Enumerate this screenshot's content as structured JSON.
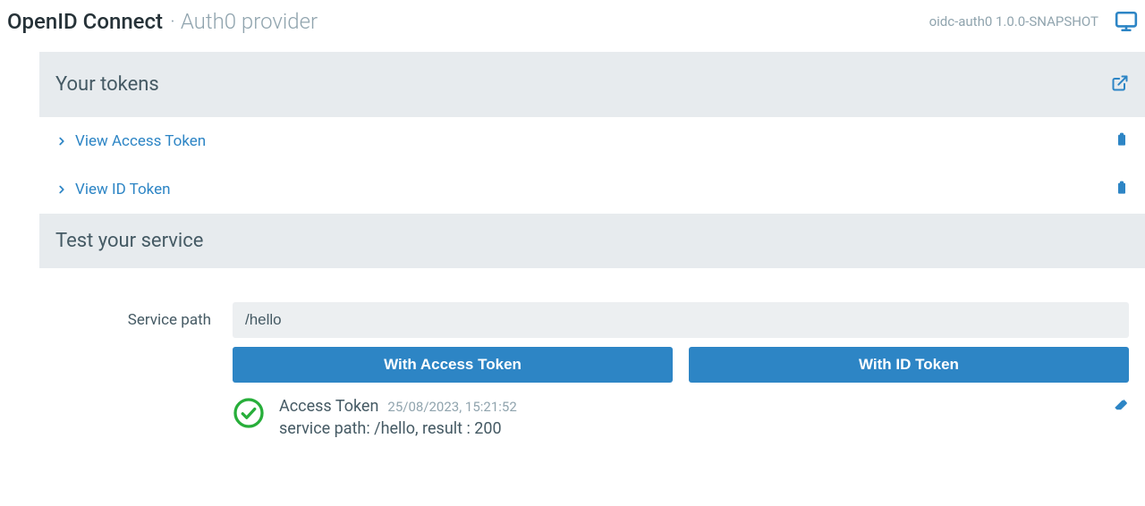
{
  "header": {
    "title": "OpenID Connect",
    "subtitle_prefix": "· ",
    "subtitle": "Auth0 provider",
    "version": "oidc-auth0 1.0.0-SNAPSHOT"
  },
  "sections": {
    "tokens": {
      "title": "Your tokens",
      "access_link": "View Access Token",
      "id_link": "View ID Token"
    },
    "test": {
      "title": "Test your service",
      "service_path_label": "Service path",
      "service_path_value": "/hello",
      "btn_access": "With Access Token",
      "btn_id": "With ID Token"
    }
  },
  "result": {
    "token_type": "Access Token",
    "timestamp": "25/08/2023, 15:21:52",
    "detail": "service path: /hello, result : 200"
  }
}
